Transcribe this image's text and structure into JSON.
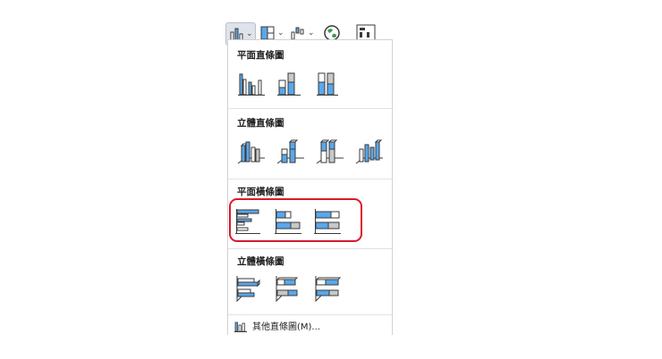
{
  "sections": [
    {
      "title": "平面直條圖"
    },
    {
      "title": "立體直條圖"
    },
    {
      "title": "平面橫條圖"
    },
    {
      "title": "立體橫條圖"
    }
  ],
  "footer": {
    "label": "其他直條圖(M)..."
  },
  "toolbar": {
    "caret": "⌄"
  },
  "colors": {
    "accent": "#5aa7ea",
    "bar_gray": "#c8c8c8",
    "outline": "#3a3a3a",
    "highlight": "#d81b2b"
  }
}
